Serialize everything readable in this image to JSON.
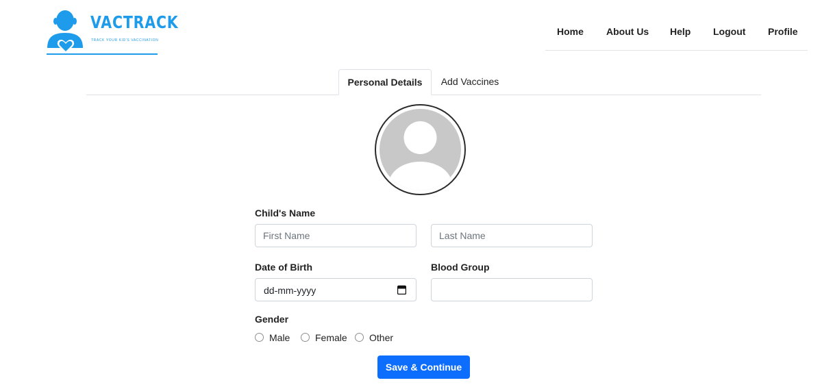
{
  "brand": {
    "name": "VACTRACK",
    "tagline": "TRACK YOUR KID'S VACCINATION",
    "color": "#1e9bea"
  },
  "nav": {
    "items": [
      {
        "label": "Home"
      },
      {
        "label": "About Us"
      },
      {
        "label": "Help"
      },
      {
        "label": "Logout"
      },
      {
        "label": "Profile"
      }
    ]
  },
  "tabs": [
    {
      "label": "Personal Details",
      "active": true
    },
    {
      "label": "Add Vaccines",
      "active": false
    }
  ],
  "form": {
    "avatar_icon": "user-placeholder-icon",
    "childs_name_label": "Child's Name",
    "first_name_placeholder": "First Name",
    "last_name_placeholder": "Last Name",
    "dob_label": "Date of Birth",
    "dob_value": "dd-mm-yyyy",
    "calendar_icon": "calendar-icon",
    "blood_group_label": "Blood Group",
    "blood_group_value": "",
    "gender_label": "Gender",
    "gender_options": [
      {
        "label": "Male",
        "checked": false
      },
      {
        "label": "Female",
        "checked": false
      },
      {
        "label": "Other",
        "checked": false
      }
    ],
    "submit_label": "Save & Continue",
    "submit_color": "#0d6efd"
  }
}
